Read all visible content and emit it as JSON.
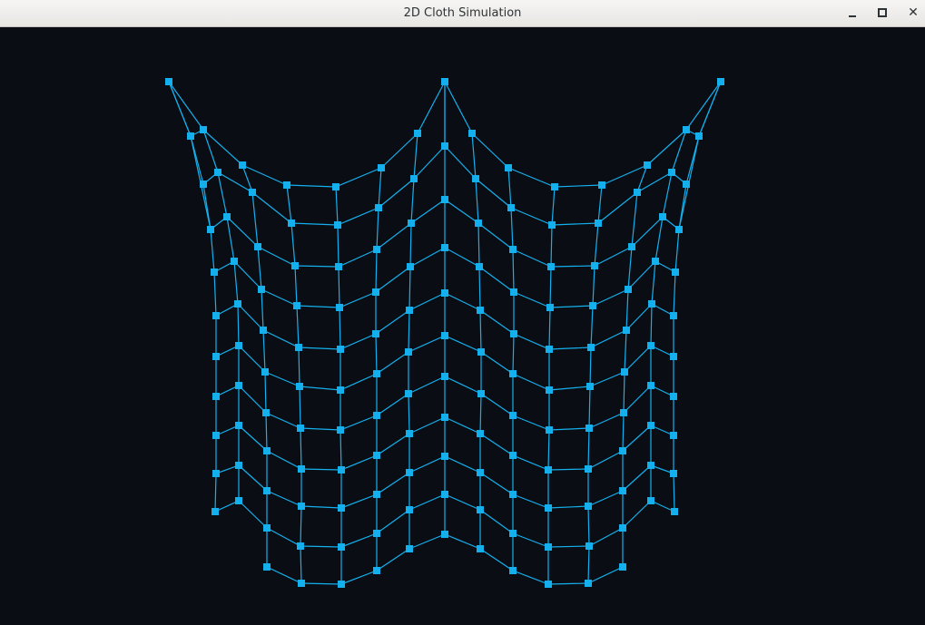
{
  "window": {
    "title": "2D Cloth Simulation"
  },
  "colors": {
    "background": "#0a0e14",
    "cloth": "#14b0ee"
  },
  "icons": {
    "minimize": "minimize-icon",
    "maximize": "maximize-icon",
    "close": "close-icon"
  }
}
